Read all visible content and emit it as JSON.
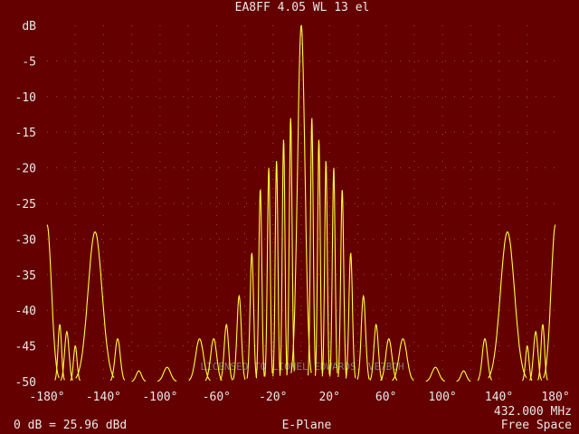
{
  "header": {
    "title": "EA8FF  4.05 WL 13 el"
  },
  "footer": {
    "left": "0 dB = 25.96 dBd",
    "center": "E-Plane",
    "right": "Free Space",
    "frequency": "432.000 MHz"
  },
  "watermark": "LICENSED TO LIONEL EDWARDS, VE7BQH",
  "colors": {
    "background": "#640000",
    "trace": "#ffff40",
    "grid": "#9a4a4a",
    "text": "#e8e8e8"
  },
  "chart_data": {
    "type": "line",
    "title": "EA8FF  4.05 WL 13 el",
    "xlim": [
      -180,
      180
    ],
    "ylim": [
      -50,
      0
    ],
    "x_ticks": [
      -180,
      -140,
      -100,
      -60,
      -20,
      20,
      60,
      100,
      140,
      180
    ],
    "x_tick_labels": [
      "-180°",
      "-140°",
      "-100°",
      "-60°",
      "-20°",
      "20°",
      "60°",
      "100°",
      "140°",
      "180°"
    ],
    "y_ticks": [
      0,
      -5,
      -10,
      -15,
      -20,
      -25,
      -30,
      -35,
      -40,
      -45,
      -50
    ],
    "y_tick_labels": [
      "dB",
      "-5",
      "-10",
      "-15",
      "-20",
      "-25",
      "-30",
      "-35",
      "-40",
      "-45",
      "-50"
    ],
    "grid": true,
    "series": [
      {
        "color": "#ffff40",
        "lobes": [
          {
            "angle": 0,
            "level": 0,
            "half_width": 4.2
          },
          {
            "angle": -7.5,
            "level": -13,
            "half_width": 1.6
          },
          {
            "angle": 7.5,
            "level": -13,
            "half_width": 1.6
          },
          {
            "angle": -12.5,
            "level": -16,
            "half_width": 1.5
          },
          {
            "angle": 12.5,
            "level": -16,
            "half_width": 1.5
          },
          {
            "angle": -17.5,
            "level": -19,
            "half_width": 1.5
          },
          {
            "angle": 17.5,
            "level": -19,
            "half_width": 1.5
          },
          {
            "angle": -23,
            "level": -20,
            "half_width": 1.6
          },
          {
            "angle": 23,
            "level": -20,
            "half_width": 1.6
          },
          {
            "angle": -29,
            "level": -23,
            "half_width": 1.7
          },
          {
            "angle": 29,
            "level": -23,
            "half_width": 1.7
          },
          {
            "angle": -35,
            "level": -32,
            "half_width": 2.0
          },
          {
            "angle": 35,
            "level": -32,
            "half_width": 2.0
          },
          {
            "angle": -44,
            "level": -38,
            "half_width": 2.5
          },
          {
            "angle": 44,
            "level": -38,
            "half_width": 2.5
          },
          {
            "angle": -53,
            "level": -42,
            "half_width": 2.5
          },
          {
            "angle": 53,
            "level": -42,
            "half_width": 2.5
          },
          {
            "angle": -62,
            "level": -44,
            "half_width": 3.5
          },
          {
            "angle": 62,
            "level": -44,
            "half_width": 3.5
          },
          {
            "angle": -72,
            "level": -44,
            "half_width": 4.5
          },
          {
            "angle": 72,
            "level": -44,
            "half_width": 4.5
          },
          {
            "angle": -95,
            "level": -48,
            "half_width": 4.0
          },
          {
            "angle": 95,
            "level": -48,
            "half_width": 4.0
          },
          {
            "angle": -115,
            "level": -48.5,
            "half_width": 3.0
          },
          {
            "angle": 115,
            "level": -48.5,
            "half_width": 3.0
          },
          {
            "angle": -130,
            "level": -44,
            "half_width": 3.0
          },
          {
            "angle": 130,
            "level": -44,
            "half_width": 3.0
          },
          {
            "angle": -146,
            "level": -29,
            "half_width": 8.0
          },
          {
            "angle": 146,
            "level": -29,
            "half_width": 8.0
          },
          {
            "angle": -160,
            "level": -45,
            "half_width": 2.0
          },
          {
            "angle": 160,
            "level": -45,
            "half_width": 2.0
          },
          {
            "angle": -166,
            "level": -43,
            "half_width": 2.5
          },
          {
            "angle": 166,
            "level": -43,
            "half_width": 2.5
          },
          {
            "angle": -171,
            "level": -42,
            "half_width": 2.0
          },
          {
            "angle": 171,
            "level": -42,
            "half_width": 2.0
          },
          {
            "angle": -180,
            "level": -28,
            "half_width": 5.0
          },
          {
            "angle": 180,
            "level": -28,
            "half_width": 5.0
          }
        ]
      }
    ]
  }
}
